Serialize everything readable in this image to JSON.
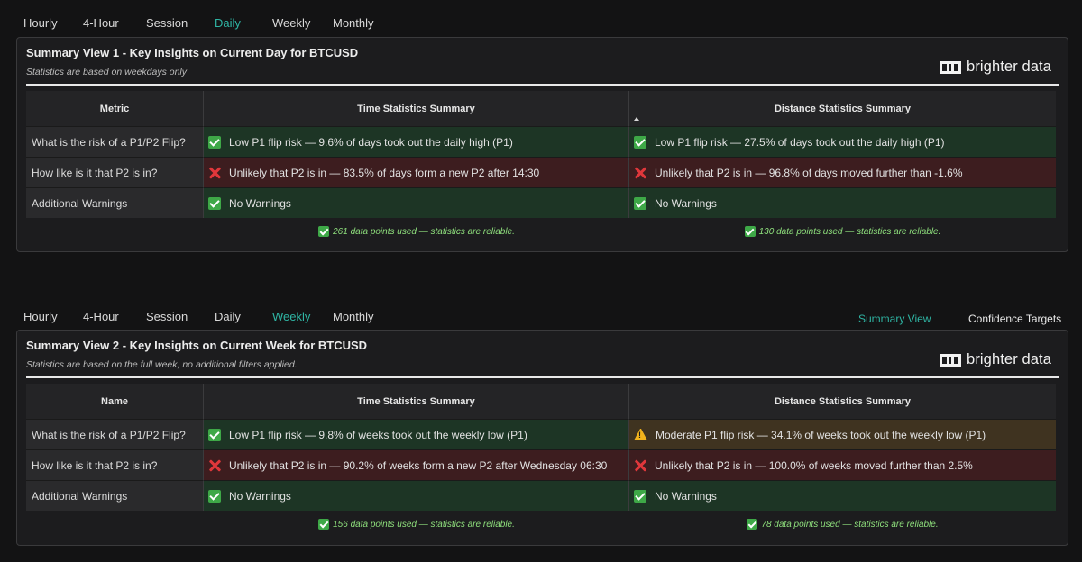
{
  "colors": {
    "accent": "#2fb5a4",
    "ok_bg": "#1d3525",
    "bad_bg": "#3d1d1f",
    "warn_bg": "#3f3320",
    "footer_text": "#8fe07d"
  },
  "section1": {
    "tabs": [
      {
        "label": "Hourly",
        "active": false
      },
      {
        "label": "4-Hour",
        "active": false
      },
      {
        "label": "Session",
        "active": false
      },
      {
        "label": "Daily",
        "active": true
      },
      {
        "label": "Weekly",
        "active": false
      },
      {
        "label": "Monthly",
        "active": false
      }
    ],
    "title": "Summary View 1 - Key Insights on Current Day for BTCUSD",
    "subtitle": "Statistics are based on weekdays only",
    "brand": "brighter data",
    "headers": {
      "col1": "Metric",
      "col2": "Time Statistics Summary",
      "col3": "Distance Statistics Summary"
    },
    "rows": [
      {
        "label": "What is the risk of a P1/P2 Flip?",
        "time": {
          "status": "ok",
          "icon": "check-icon",
          "text": "Low P1 flip risk — 9.6% of days took out the daily high (P1)"
        },
        "distance": {
          "status": "ok",
          "icon": "check-icon",
          "text": "Low P1 flip risk — 27.5% of days took out the daily high (P1)"
        }
      },
      {
        "label": "How like is it that P2 is in?",
        "time": {
          "status": "bad",
          "icon": "cross-icon",
          "text": "Unlikely that P2 is in — 83.5% of days form a new P2 after 14:30"
        },
        "distance": {
          "status": "bad",
          "icon": "cross-icon",
          "text": "Unlikely that P2 is in — 96.8% of days moved further than -1.6%"
        }
      },
      {
        "label": "Additional Warnings",
        "time": {
          "status": "ok",
          "icon": "check-icon",
          "text": "No Warnings"
        },
        "distance": {
          "status": "ok",
          "icon": "check-icon",
          "text": "No Warnings"
        }
      }
    ],
    "footer": {
      "time": "261 data points used — statistics are reliable.",
      "distance": "130 data points used — statistics are reliable."
    }
  },
  "section2": {
    "tabs": [
      {
        "label": "Hourly",
        "active": false
      },
      {
        "label": "4-Hour",
        "active": false
      },
      {
        "label": "Session",
        "active": false
      },
      {
        "label": "Daily",
        "active": false
      },
      {
        "label": "Weekly",
        "active": true
      },
      {
        "label": "Monthly",
        "active": false
      }
    ],
    "view_tabs": [
      {
        "label": "Summary View",
        "active": true
      },
      {
        "label": "Confidence Targets",
        "active": false
      }
    ],
    "title": "Summary View 2 - Key Insights on Current Week for BTCUSD",
    "subtitle": "Statistics are based on the full week, no additional filters applied.",
    "brand": "brighter data",
    "headers": {
      "col1": "Name",
      "col2": "Time Statistics Summary",
      "col3": "Distance Statistics Summary"
    },
    "rows": [
      {
        "label": "What is the risk of a P1/P2 Flip?",
        "time": {
          "status": "ok",
          "icon": "check-icon",
          "text": "Low P1 flip risk — 9.8% of weeks took out the weekly low (P1)"
        },
        "distance": {
          "status": "warn",
          "icon": "warning-icon",
          "text": "Moderate P1 flip risk — 34.1% of weeks took out the weekly low (P1)"
        }
      },
      {
        "label": "How like is it that P2 is in?",
        "time": {
          "status": "bad",
          "icon": "cross-icon",
          "text": "Unlikely that P2 is in — 90.2% of weeks form a new P2 after Wednesday 06:30"
        },
        "distance": {
          "status": "bad",
          "icon": "cross-icon",
          "text": "Unlikely that P2 is in — 100.0% of weeks moved further than 2.5%"
        }
      },
      {
        "label": "Additional Warnings",
        "time": {
          "status": "ok",
          "icon": "check-icon",
          "text": "No Warnings"
        },
        "distance": {
          "status": "ok",
          "icon": "check-icon",
          "text": "No Warnings"
        }
      }
    ],
    "footer": {
      "time": "156 data points used — statistics are reliable.",
      "distance": "78 data points used — statistics are reliable."
    }
  }
}
